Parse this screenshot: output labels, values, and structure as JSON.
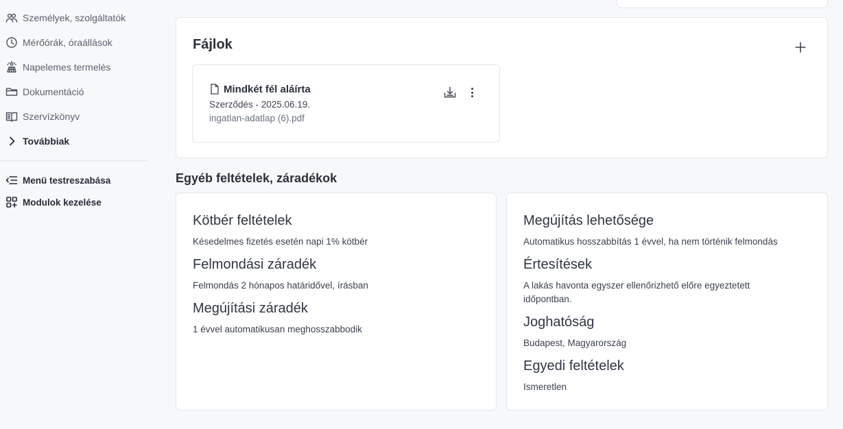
{
  "sidebar": {
    "items": [
      {
        "label": "Személyek, szolgáltatók",
        "icon": "people-icon"
      },
      {
        "label": "Mérőórák, óraállások",
        "icon": "clock-icon"
      },
      {
        "label": "Napelemes termelés",
        "icon": "solar-panel-icon"
      },
      {
        "label": "Dokumentáció",
        "icon": "folder-icon"
      },
      {
        "label": "Szervízkönyv",
        "icon": "book-icon"
      }
    ],
    "more_label": "Továbbiak",
    "customize_label": "Menü testreszabása",
    "modules_label": "Modulok kezelése"
  },
  "files": {
    "title": "Fájlok",
    "item": {
      "name": "Mindkét fél aláírta",
      "subtitle": "Szerződés - 2025.06.19.",
      "filename": "ingatlan-adatlap (6).pdf"
    }
  },
  "terms": {
    "heading": "Egyéb feltételek, záradékok",
    "left": [
      {
        "title": "Kötbér feltételek",
        "value": "Késedelmes fizetés esetén napi 1% kötbér"
      },
      {
        "title": "Felmondási záradék",
        "value": "Felmondás 2 hónapos határidővel, írásban"
      },
      {
        "title": "Megújítási záradék",
        "value": "1 évvel automatikusan meghosszabbodik"
      }
    ],
    "right": [
      {
        "title": "Megújítás lehetősége",
        "value": "Automatikus hosszabbítás 1 évvel, ha nem történik felmondás"
      },
      {
        "title": "Értesítések",
        "value": "A lakás havonta egyszer ellenőrizhető előre egyeztetett időpontban."
      },
      {
        "title": "Joghatóság",
        "value": "Budapest, Magyarország"
      },
      {
        "title": "Egyedi feltételek",
        "value": "Ismeretlen"
      }
    ]
  }
}
